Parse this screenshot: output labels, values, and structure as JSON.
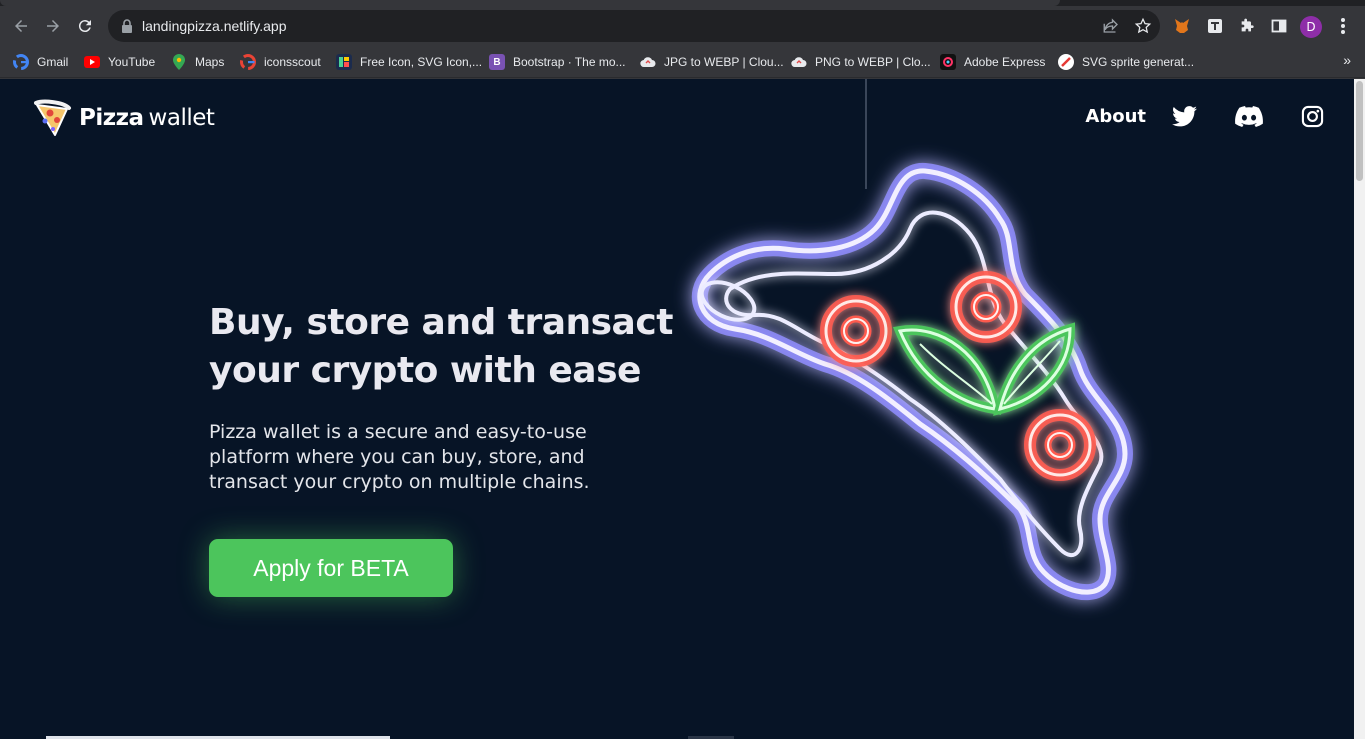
{
  "browser": {
    "url": "landingpizza.netlify.app",
    "profile_initial": "D"
  },
  "bookmarks": [
    {
      "label": "Gmail",
      "icon": "google-icon",
      "color": "#ffffff"
    },
    {
      "label": "YouTube",
      "icon": "youtube-icon",
      "color": "#ff0000"
    },
    {
      "label": "Maps",
      "icon": "maps-icon",
      "color": "#34a853"
    },
    {
      "label": "iconsscout",
      "icon": "google-icon",
      "color": "#ffffff"
    },
    {
      "label": "Free Icon, SVG Icon,...",
      "icon": "flaticon-icon",
      "color": "#1b2b4d"
    },
    {
      "label": "Bootstrap · The mo...",
      "icon": "bootstrap-icon",
      "color": "#7952b3"
    },
    {
      "label": "JPG to WEBP | Clou...",
      "icon": "cloudconvert-icon",
      "color": "#e8eaed"
    },
    {
      "label": "PNG to WEBP | Clo...",
      "icon": "cloudconvert-icon",
      "color": "#e8eaed"
    },
    {
      "label": "Adobe Express",
      "icon": "adobe-express-icon",
      "color": "#111111"
    },
    {
      "label": "SVG sprite generat...",
      "icon": "svg-sprite-icon",
      "color": "#ffffff"
    }
  ],
  "page": {
    "logo": {
      "bold": "Pizza",
      "light": "wallet"
    },
    "nav": {
      "about": "About"
    },
    "hero": {
      "title": "Buy, store and transact your crypto with ease",
      "description": "Pizza wallet is a secure and easy-to-use platform where you can buy, store, and transact your crypto on multiple chains.",
      "cta": "Apply for BETA"
    }
  },
  "colors": {
    "page_bg": "#071426",
    "accent_green": "#4cc55c",
    "neon_purple": "#8f8cff",
    "neon_red": "#ff5a4e"
  }
}
